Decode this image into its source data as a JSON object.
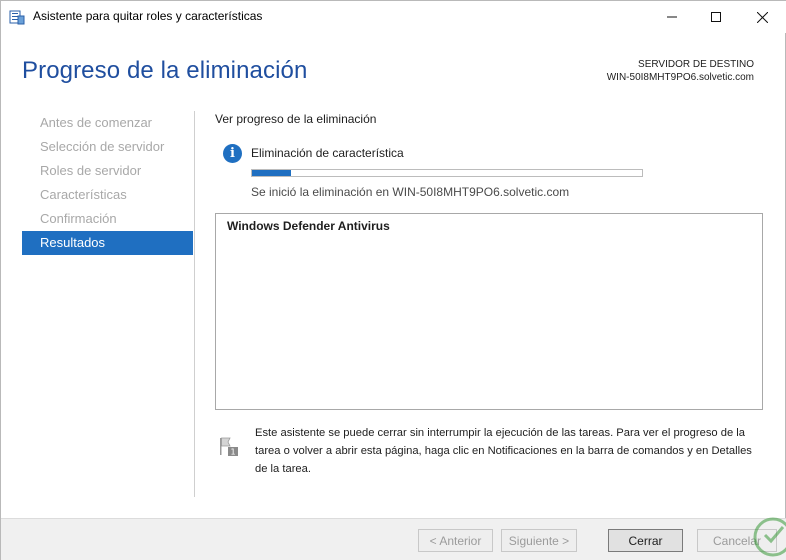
{
  "window": {
    "title": "Asistente para quitar roles y características",
    "icon": "server-manager-wizard-icon"
  },
  "page_title": "Progreso de la eliminación",
  "destination": {
    "label": "SERVIDOR DE DESTINO",
    "server": "WIN-50I8MHT9PO6.solvetic.com"
  },
  "nav": {
    "items": [
      {
        "label": "Antes de comenzar",
        "active": false
      },
      {
        "label": "Selección de servidor",
        "active": false
      },
      {
        "label": "Roles de servidor",
        "active": false
      },
      {
        "label": "Características",
        "active": false
      },
      {
        "label": "Confirmación",
        "active": false
      },
      {
        "label": "Resultados",
        "active": true
      }
    ]
  },
  "content": {
    "section_label": "Ver progreso de la eliminación",
    "status_title": "Eliminación de característica",
    "progress_fraction": 0.1,
    "status_sub": "Se inició la eliminación en WIN-50I8MHT9PO6.solvetic.com",
    "results": [
      "Windows Defender Antivirus"
    ],
    "note": "Este asistente se puede cerrar sin interrumpir la ejecución de las tareas. Para ver el progreso de la tarea o volver a abrir esta página, haga clic en Notificaciones en la barra de comandos y en Detalles de la tarea."
  },
  "buttons": {
    "back": "< Anterior",
    "next": "Siguiente >",
    "close": "Cerrar",
    "cancel": "Cancelar"
  },
  "colors": {
    "accent": "#1f6fc1",
    "title": "#1f4e9f",
    "inactive_nav": "#a8a8a8"
  }
}
